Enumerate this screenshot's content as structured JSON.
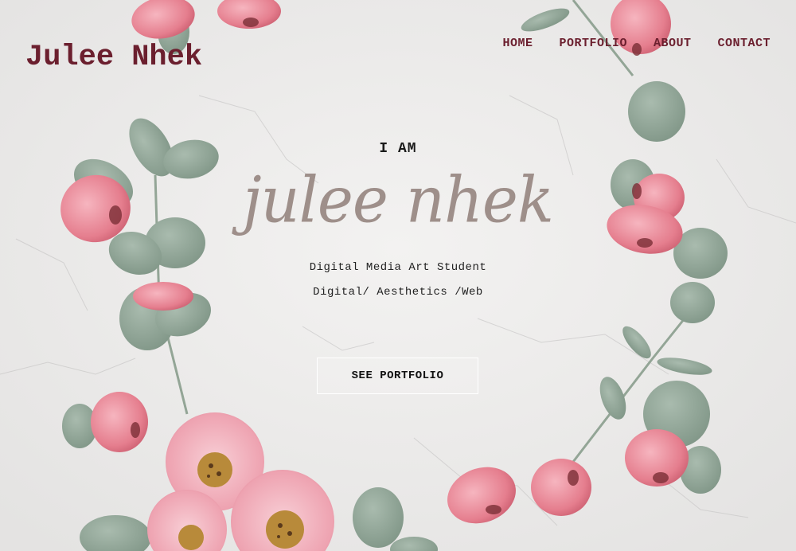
{
  "site": {
    "logo": "Julee Nhek"
  },
  "nav": {
    "items": [
      {
        "label": "HOME"
      },
      {
        "label": "PORTFOLIO"
      },
      {
        "label": "ABOUT"
      },
      {
        "label": "CONTACT"
      }
    ]
  },
  "hero": {
    "intro": "I AM",
    "name_script": "julee nhek",
    "subtitle": "Digital Media Art Student",
    "tags": "Digital/ Aesthetics /Web",
    "cta_label": "SEE PORTFOLIO"
  },
  "colors": {
    "brand": "#6b1f2e",
    "script": "#9e8f8a",
    "background": "#ecebea",
    "petal": "#e58a97",
    "leaf": "#8fa496",
    "rose": "#f0b3bf"
  }
}
